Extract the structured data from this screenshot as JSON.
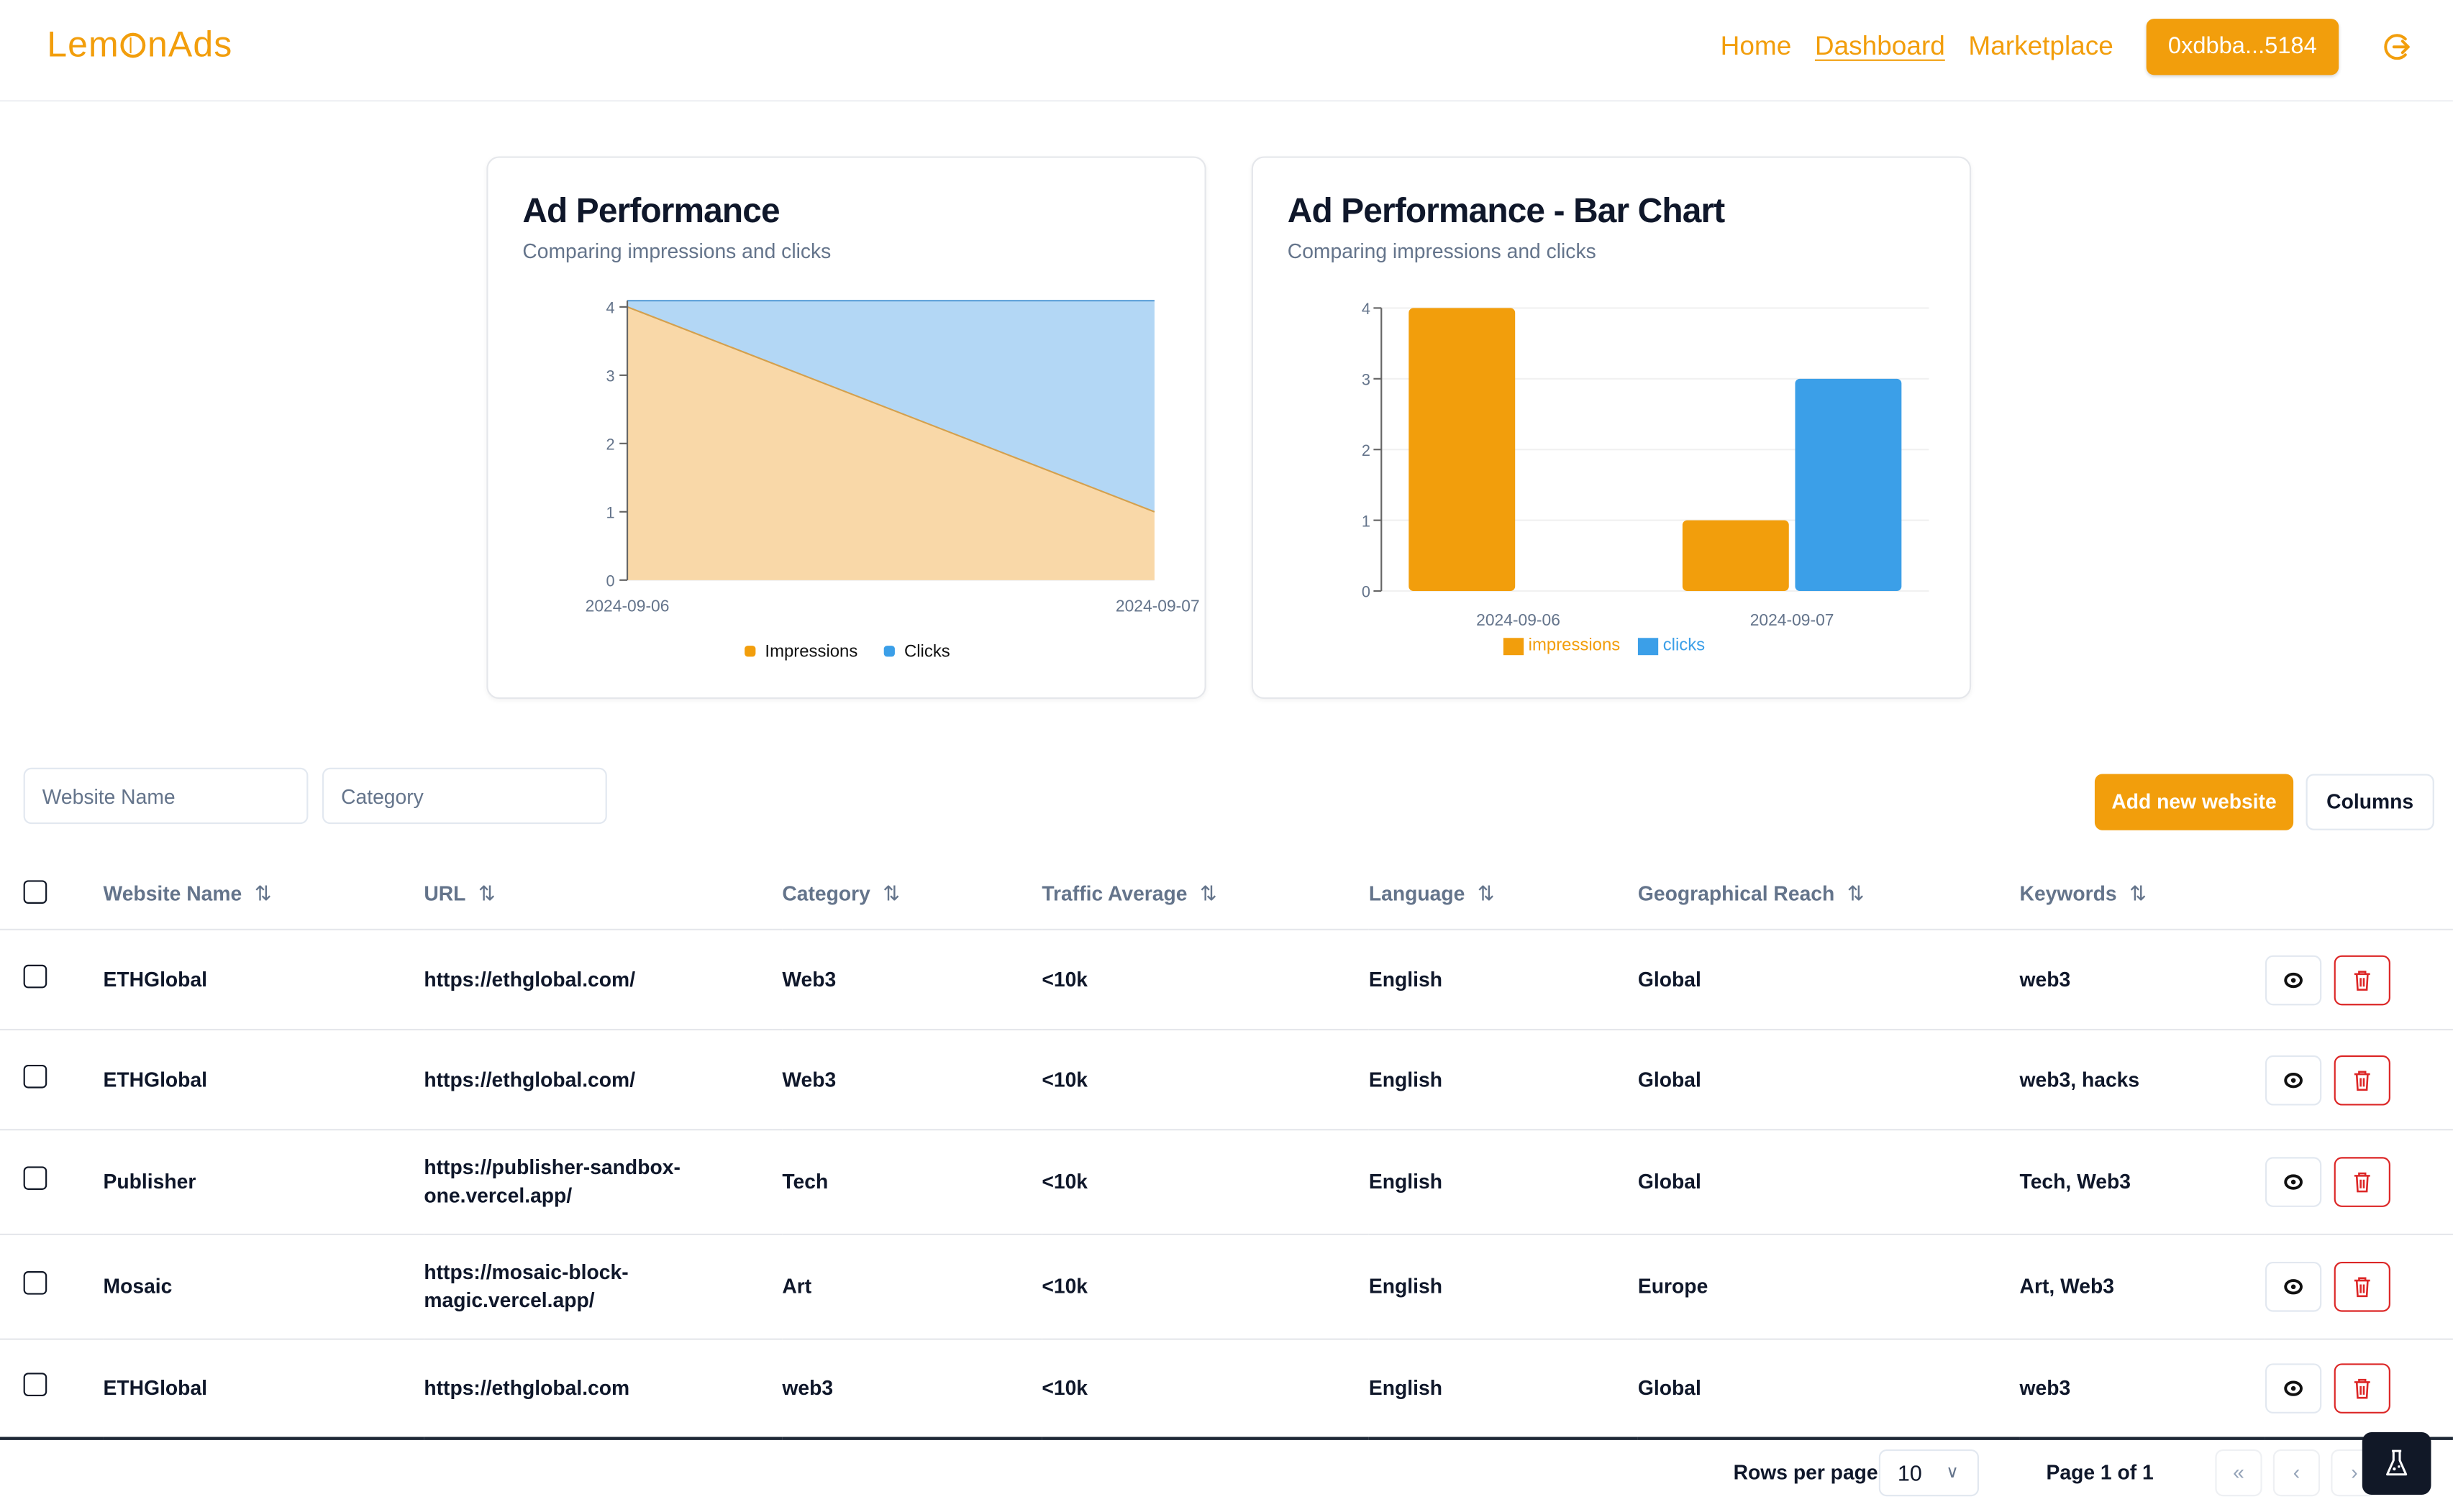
{
  "header": {
    "logo": {
      "before": "Lem",
      "after": "nAds"
    },
    "nav": [
      {
        "label": "Home",
        "active": false
      },
      {
        "label": "Dashboard",
        "active": true
      },
      {
        "label": "Marketplace",
        "active": false
      }
    ],
    "wallet": "0xdbba...5184",
    "brand_color": "#f29e0c"
  },
  "charts": {
    "area": {
      "title": "Ad Performance",
      "subtitle": "Comparing impressions and clicks"
    },
    "bar": {
      "title": "Ad Performance - Bar Chart",
      "subtitle": "Comparing impressions and clicks"
    }
  },
  "chart_data": [
    {
      "type": "area",
      "stacked": true,
      "title": "Ad Performance",
      "subtitle": "Comparing impressions and clicks",
      "x": [
        "2024-09-06",
        "2024-09-07"
      ],
      "series": [
        {
          "name": "Impressions",
          "values": [
            4,
            1
          ],
          "color": "#f29e0c"
        },
        {
          "name": "Clicks",
          "values": [
            0,
            3
          ],
          "color": "#3b9fe8"
        }
      ],
      "yticks": [
        0,
        1,
        2,
        3,
        4
      ],
      "ylim": [
        0,
        4
      ],
      "legend": "bottom",
      "grid": true
    },
    {
      "type": "bar",
      "title": "Ad Performance - Bar Chart",
      "subtitle": "Comparing impressions and clicks",
      "categories": [
        "2024-09-06",
        "2024-09-07"
      ],
      "series": [
        {
          "name": "impressions",
          "values": [
            4,
            1
          ],
          "color": "#f29e0c"
        },
        {
          "name": "clicks",
          "values": [
            0,
            3
          ],
          "color": "#3b9fe8"
        }
      ],
      "yticks": [
        0,
        1,
        2,
        3,
        4
      ],
      "ylim": [
        0,
        4
      ],
      "legend": "bottom",
      "grid": true
    }
  ],
  "filters": {
    "website_name_placeholder": "Website Name",
    "category_placeholder": "Category",
    "website_name_value": "",
    "category_value": ""
  },
  "toolbar": {
    "add_label": "Add new website",
    "columns_label": "Columns"
  },
  "table": {
    "columns": [
      "Website Name",
      "URL",
      "Category",
      "Traffic Average",
      "Language",
      "Geographical Reach",
      "Keywords"
    ],
    "rows": [
      {
        "name": "ETHGlobal",
        "url": "https://ethglobal.com/",
        "category": "Web3",
        "traffic": "<10k",
        "language": "English",
        "reach": "Global",
        "keywords": "web3"
      },
      {
        "name": "ETHGlobal",
        "url": "https://ethglobal.com/",
        "category": "Web3",
        "traffic": "<10k",
        "language": "English",
        "reach": "Global",
        "keywords": "web3, hacks"
      },
      {
        "name": "Publisher",
        "url": "https://publisher-sandbox-one.vercel.app/",
        "category": "Tech",
        "traffic": "<10k",
        "language": "English",
        "reach": "Global",
        "keywords": "Tech, Web3"
      },
      {
        "name": "Mosaic",
        "url": "https://mosaic-block-magic.vercel.app/",
        "category": "Art",
        "traffic": "<10k",
        "language": "English",
        "reach": "Europe",
        "keywords": "Art, Web3"
      },
      {
        "name": "ETHGlobal",
        "url": "https://ethglobal.com",
        "category": "web3",
        "traffic": "<10k",
        "language": "English",
        "reach": "Global",
        "keywords": "web3"
      }
    ]
  },
  "pagination": {
    "rows_per_page_label": "Rows per page",
    "rows_per_page": "10",
    "page_info": "Page 1 of 1"
  },
  "icons": {
    "sort": "⇅",
    "first": "«",
    "prev": "‹",
    "next": "›",
    "chevron": "∨"
  }
}
